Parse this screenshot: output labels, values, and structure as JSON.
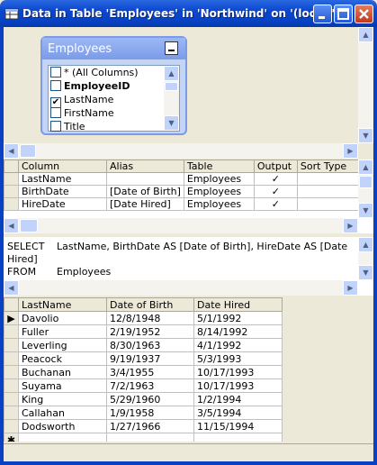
{
  "window": {
    "title": "Data in Table 'Employees' in 'Northwind' on '(local)'",
    "min_icon": "minimize-icon",
    "max_icon": "maximize-icon",
    "close_icon": "close-icon"
  },
  "diagram": {
    "table_name": "Employees",
    "fields": [
      {
        "label": "* (All Columns)",
        "checked": false,
        "bold": false
      },
      {
        "label": "EmployeeID",
        "checked": false,
        "bold": true
      },
      {
        "label": "LastName",
        "checked": true,
        "bold": false
      },
      {
        "label": "FirstName",
        "checked": false,
        "bold": false
      },
      {
        "label": "Title",
        "checked": false,
        "bold": false
      }
    ]
  },
  "grid": {
    "headers": [
      "Column",
      "Alias",
      "Table",
      "Output",
      "Sort Type"
    ],
    "rows": [
      {
        "column": "LastName",
        "alias": "",
        "table": "Employees",
        "output": "✓"
      },
      {
        "column": "BirthDate",
        "alias": "[Date of Birth]",
        "table": "Employees",
        "output": "✓"
      },
      {
        "column": "HireDate",
        "alias": "[Date Hired]",
        "table": "Employees",
        "output": "✓"
      }
    ]
  },
  "sql": {
    "select_kw": "SELECT",
    "select_text": "LastName, BirthDate AS [Date of Birth], HireDate AS [Date Hired]",
    "from_kw": "FROM",
    "from_text": "Employees"
  },
  "results": {
    "headers": [
      "LastName",
      "Date of Birth",
      "Date Hired"
    ],
    "rows": [
      [
        "Davolio",
        "12/8/1948",
        "5/1/1992"
      ],
      [
        "Fuller",
        "2/19/1952",
        "8/14/1992"
      ],
      [
        "Leverling",
        "8/30/1963",
        "4/1/1992"
      ],
      [
        "Peacock",
        "9/19/1937",
        "5/3/1993"
      ],
      [
        "Buchanan",
        "3/4/1955",
        "10/17/1993"
      ],
      [
        "Suyama",
        "7/2/1963",
        "10/17/1993"
      ],
      [
        "King",
        "5/29/1960",
        "1/2/1994"
      ],
      [
        "Callahan",
        "1/9/1958",
        "3/5/1994"
      ],
      [
        "Dodsworth",
        "1/27/1966",
        "11/15/1994"
      ]
    ],
    "current_row_marker": "▶",
    "new_row_marker": "✱"
  }
}
